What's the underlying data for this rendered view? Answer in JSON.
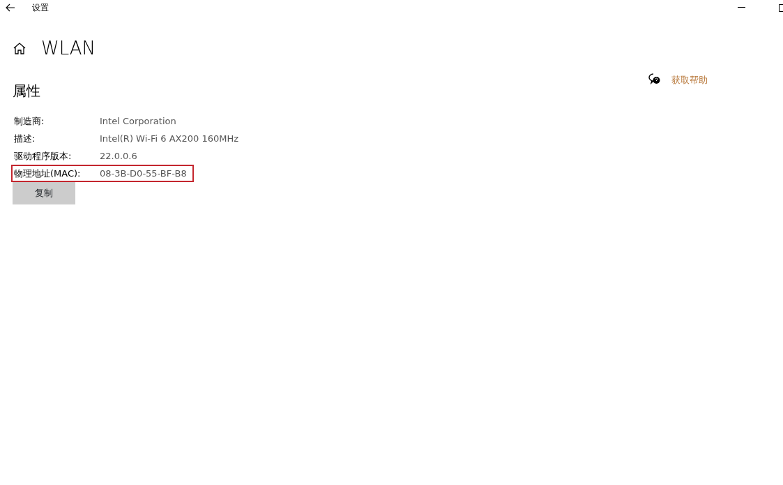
{
  "window": {
    "title": "设置"
  },
  "page": {
    "title": "WLAN"
  },
  "section": {
    "title": "属性"
  },
  "help": {
    "label": "获取帮助"
  },
  "properties": [
    {
      "label": "制造商:",
      "value": "Intel Corporation",
      "highlighted": false
    },
    {
      "label": "描述:",
      "value": "Intel(R) Wi-Fi 6 AX200 160MHz",
      "highlighted": false
    },
    {
      "label": "驱动程序版本:",
      "value": "22.0.0.6",
      "highlighted": false
    },
    {
      "label": "物理地址(MAC):",
      "value": "08-3B-D0-55-BF-B8",
      "highlighted": true
    }
  ],
  "buttons": [
    {
      "label": "复制"
    }
  ]
}
